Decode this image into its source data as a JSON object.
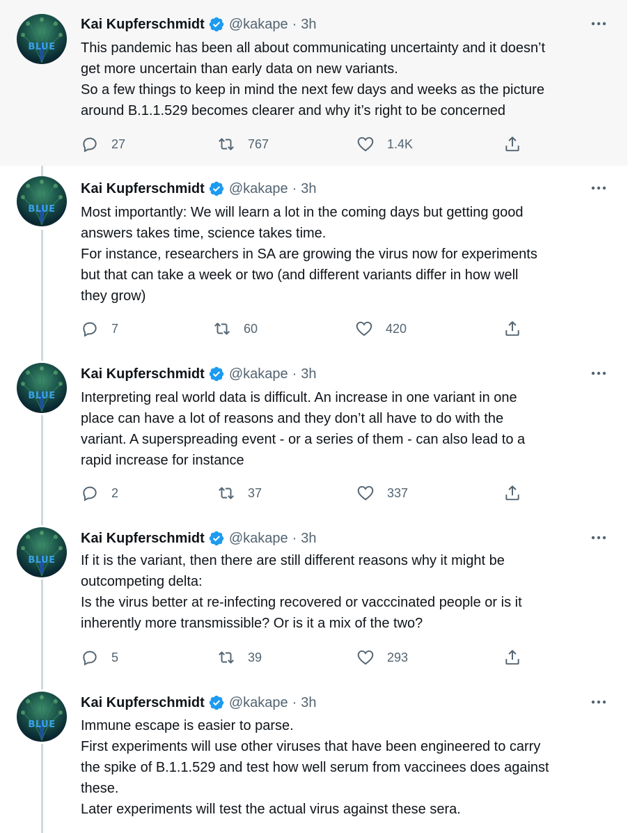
{
  "tweets": [
    {
      "name": "Kai Kupferschmidt",
      "handle": "@kakape",
      "separator": "·",
      "time": "3h",
      "highlighted": true,
      "lines": [
        "This pandemic has been all about communicating uncertainty and it doesn’t",
        "get more uncertain than early data on new variants.",
        "So a few things to keep in mind the next few days and weeks as the picture",
        "around B.1.1.529 becomes clearer and why it’s right to be concerned"
      ],
      "replies": "27",
      "retweets": "767",
      "likes": "1.4K"
    },
    {
      "name": "Kai Kupferschmidt",
      "handle": "@kakape",
      "separator": "·",
      "time": "3h",
      "highlighted": false,
      "lines": [
        "Most importantly: We will learn a lot in the coming days but getting good",
        "answers takes time, science takes time.",
        "For instance, researchers in SA are growing the virus now for experiments",
        "but that can take a week or two (and different variants differ in how well",
        "they grow)"
      ],
      "replies": "7",
      "retweets": "60",
      "likes": "420"
    },
    {
      "name": "Kai Kupferschmidt",
      "handle": "@kakape",
      "separator": "·",
      "time": "3h",
      "highlighted": false,
      "lines": [
        "Interpreting real world data is difficult. An increase in one variant in one",
        "place can have a lot of reasons and they don’t all have to do with the",
        "variant. A superspreading event - or a series of them - can also lead to a",
        "rapid increase for instance"
      ],
      "replies": "2",
      "retweets": "37",
      "likes": "337"
    },
    {
      "name": "Kai Kupferschmidt",
      "handle": "@kakape",
      "separator": "·",
      "time": "3h",
      "highlighted": false,
      "lines": [
        "If it is the variant, then there are still different reasons why it might be",
        "outcompeting delta:",
        "Is the virus better at re-infecting recovered or vacccinated people or is it",
        "inherently more transmissible? Or is it a mix of the two?"
      ],
      "replies": "5",
      "retweets": "39",
      "likes": "293"
    },
    {
      "name": "Kai Kupferschmidt",
      "handle": "@kakape",
      "separator": "·",
      "time": "3h",
      "highlighted": false,
      "lines": [
        "Immune escape is easier to parse.",
        "First experiments will use other viruses that have been engineered to carry",
        "the spike of B.1.1.529 and test how well serum from vaccinees does against",
        "these.",
        "Later experiments will test the actual virus against these sera."
      ]
    }
  ],
  "avatar_text": "BLUE",
  "icons": {
    "reply": "reply-icon",
    "retweet": "retweet-icon",
    "like": "heart-icon",
    "share": "share-icon",
    "more": "more-options-icon",
    "verified": "verified-badge-icon"
  },
  "colors": {
    "text": "#0f1419",
    "secondary": "#536471",
    "verified": "#1d9bf0",
    "highlight_bg": "#f7f7f7",
    "thread_line": "#cfd9de"
  }
}
